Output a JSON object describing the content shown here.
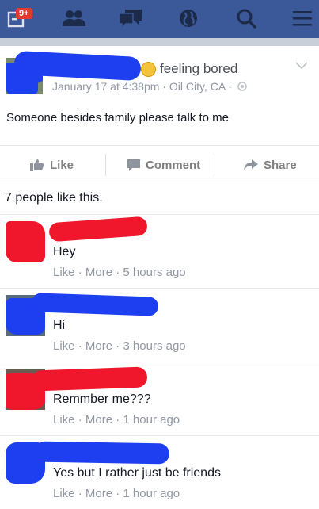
{
  "topbar": {
    "notification_count": "9+",
    "icons": [
      "notifications-icon",
      "friend-requests-icon",
      "messages-icon",
      "globe-icon",
      "search-icon",
      "menu-icon"
    ],
    "bar_color": "#3b5998"
  },
  "post": {
    "feeling": "feeling bored",
    "meta": "January 17 at 4:38pm · Oil City, CA ·",
    "text": "Someone besides family please talk to me"
  },
  "actions": {
    "like": "Like",
    "comment": "Comment",
    "share": "Share"
  },
  "likes_summary": "7 people like this.",
  "comments": [
    {
      "text": "Hey",
      "like": "Like",
      "more": "More",
      "time": "5 hours ago"
    },
    {
      "text": "Hi",
      "like": "Like",
      "more": "More",
      "time": "3 hours ago"
    },
    {
      "text": "Remmber me???",
      "like": "Like",
      "more": "More",
      "time": "1 hour ago"
    },
    {
      "text": "Yes but I rather just be friends",
      "like": "Like",
      "more": "More",
      "time": "1 hour ago"
    }
  ],
  "redaction_colors": {
    "blue": "#1d3ff0",
    "red": "#f0162b"
  }
}
